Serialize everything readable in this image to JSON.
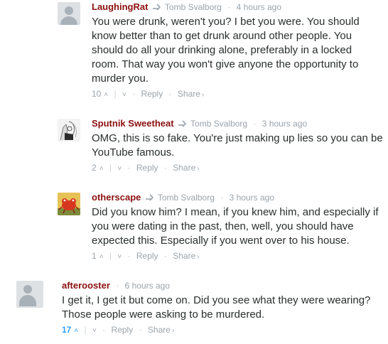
{
  "comments": [
    {
      "author": "LaughingRat",
      "reply_to": "Tomb Svalborg",
      "time": "4 hours ago",
      "text": "You were drunk, weren't you? I bet you were. You should know better than to get drunk around other people. You should do all your drinking alone, preferably in a locked room. That way you won't give anyone the opportunity to murder you.",
      "votes": "10",
      "reply_label": "Reply",
      "share_label": "Share"
    },
    {
      "author": "Sputnik Sweetheat",
      "reply_to": "Tomb Svalborg",
      "time": "3 hours ago",
      "text": "OMG, this is so fake. You're just making up lies so you can be YouTube famous.",
      "votes": "2",
      "reply_label": "Reply",
      "share_label": "Share"
    },
    {
      "author": "otherscape",
      "reply_to": "Tomb Svalborg",
      "time": "3 hours ago",
      "text": "Did you know him? I mean, if you knew him, and especially if you were dating in the past, then, well, you should have expected this. Especially if you went over to his house.",
      "votes": "1",
      "reply_label": "Reply",
      "share_label": "Share"
    },
    {
      "author": "afterooster",
      "time": "6 hours ago",
      "text": "I get it, I get it but come on. Did you see what they were wearing? Those people were asking to be murdered.",
      "votes": "17",
      "reply_label": "Reply",
      "share_label": "Share"
    }
  ],
  "colors": {
    "author": "#8b0f0f",
    "meta": "#9aa3ab",
    "text": "#2a2e2e",
    "upvote_active": "#2e9fff"
  },
  "icons": {
    "reply_to": "reply-arrow-icon",
    "upvote": "chevron-up-icon",
    "downvote": "chevron-down-icon",
    "share": "chevron-right-icon"
  }
}
